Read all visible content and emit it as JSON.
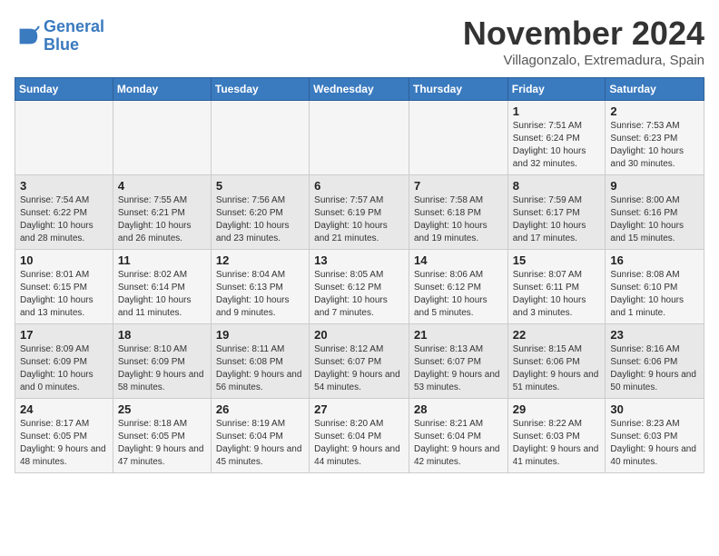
{
  "logo": {
    "line1": "General",
    "line2": "Blue"
  },
  "title": "November 2024",
  "subtitle": "Villagonzalo, Extremadura, Spain",
  "headers": [
    "Sunday",
    "Monday",
    "Tuesday",
    "Wednesday",
    "Thursday",
    "Friday",
    "Saturday"
  ],
  "weeks": [
    [
      {
        "day": "",
        "info": ""
      },
      {
        "day": "",
        "info": ""
      },
      {
        "day": "",
        "info": ""
      },
      {
        "day": "",
        "info": ""
      },
      {
        "day": "",
        "info": ""
      },
      {
        "day": "1",
        "info": "Sunrise: 7:51 AM\nSunset: 6:24 PM\nDaylight: 10 hours and 32 minutes."
      },
      {
        "day": "2",
        "info": "Sunrise: 7:53 AM\nSunset: 6:23 PM\nDaylight: 10 hours and 30 minutes."
      }
    ],
    [
      {
        "day": "3",
        "info": "Sunrise: 7:54 AM\nSunset: 6:22 PM\nDaylight: 10 hours and 28 minutes."
      },
      {
        "day": "4",
        "info": "Sunrise: 7:55 AM\nSunset: 6:21 PM\nDaylight: 10 hours and 26 minutes."
      },
      {
        "day": "5",
        "info": "Sunrise: 7:56 AM\nSunset: 6:20 PM\nDaylight: 10 hours and 23 minutes."
      },
      {
        "day": "6",
        "info": "Sunrise: 7:57 AM\nSunset: 6:19 PM\nDaylight: 10 hours and 21 minutes."
      },
      {
        "day": "7",
        "info": "Sunrise: 7:58 AM\nSunset: 6:18 PM\nDaylight: 10 hours and 19 minutes."
      },
      {
        "day": "8",
        "info": "Sunrise: 7:59 AM\nSunset: 6:17 PM\nDaylight: 10 hours and 17 minutes."
      },
      {
        "day": "9",
        "info": "Sunrise: 8:00 AM\nSunset: 6:16 PM\nDaylight: 10 hours and 15 minutes."
      }
    ],
    [
      {
        "day": "10",
        "info": "Sunrise: 8:01 AM\nSunset: 6:15 PM\nDaylight: 10 hours and 13 minutes."
      },
      {
        "day": "11",
        "info": "Sunrise: 8:02 AM\nSunset: 6:14 PM\nDaylight: 10 hours and 11 minutes."
      },
      {
        "day": "12",
        "info": "Sunrise: 8:04 AM\nSunset: 6:13 PM\nDaylight: 10 hours and 9 minutes."
      },
      {
        "day": "13",
        "info": "Sunrise: 8:05 AM\nSunset: 6:12 PM\nDaylight: 10 hours and 7 minutes."
      },
      {
        "day": "14",
        "info": "Sunrise: 8:06 AM\nSunset: 6:12 PM\nDaylight: 10 hours and 5 minutes."
      },
      {
        "day": "15",
        "info": "Sunrise: 8:07 AM\nSunset: 6:11 PM\nDaylight: 10 hours and 3 minutes."
      },
      {
        "day": "16",
        "info": "Sunrise: 8:08 AM\nSunset: 6:10 PM\nDaylight: 10 hours and 1 minute."
      }
    ],
    [
      {
        "day": "17",
        "info": "Sunrise: 8:09 AM\nSunset: 6:09 PM\nDaylight: 10 hours and 0 minutes."
      },
      {
        "day": "18",
        "info": "Sunrise: 8:10 AM\nSunset: 6:09 PM\nDaylight: 9 hours and 58 minutes."
      },
      {
        "day": "19",
        "info": "Sunrise: 8:11 AM\nSunset: 6:08 PM\nDaylight: 9 hours and 56 minutes."
      },
      {
        "day": "20",
        "info": "Sunrise: 8:12 AM\nSunset: 6:07 PM\nDaylight: 9 hours and 54 minutes."
      },
      {
        "day": "21",
        "info": "Sunrise: 8:13 AM\nSunset: 6:07 PM\nDaylight: 9 hours and 53 minutes."
      },
      {
        "day": "22",
        "info": "Sunrise: 8:15 AM\nSunset: 6:06 PM\nDaylight: 9 hours and 51 minutes."
      },
      {
        "day": "23",
        "info": "Sunrise: 8:16 AM\nSunset: 6:06 PM\nDaylight: 9 hours and 50 minutes."
      }
    ],
    [
      {
        "day": "24",
        "info": "Sunrise: 8:17 AM\nSunset: 6:05 PM\nDaylight: 9 hours and 48 minutes."
      },
      {
        "day": "25",
        "info": "Sunrise: 8:18 AM\nSunset: 6:05 PM\nDaylight: 9 hours and 47 minutes."
      },
      {
        "day": "26",
        "info": "Sunrise: 8:19 AM\nSunset: 6:04 PM\nDaylight: 9 hours and 45 minutes."
      },
      {
        "day": "27",
        "info": "Sunrise: 8:20 AM\nSunset: 6:04 PM\nDaylight: 9 hours and 44 minutes."
      },
      {
        "day": "28",
        "info": "Sunrise: 8:21 AM\nSunset: 6:04 PM\nDaylight: 9 hours and 42 minutes."
      },
      {
        "day": "29",
        "info": "Sunrise: 8:22 AM\nSunset: 6:03 PM\nDaylight: 9 hours and 41 minutes."
      },
      {
        "day": "30",
        "info": "Sunrise: 8:23 AM\nSunset: 6:03 PM\nDaylight: 9 hours and 40 minutes."
      }
    ]
  ]
}
